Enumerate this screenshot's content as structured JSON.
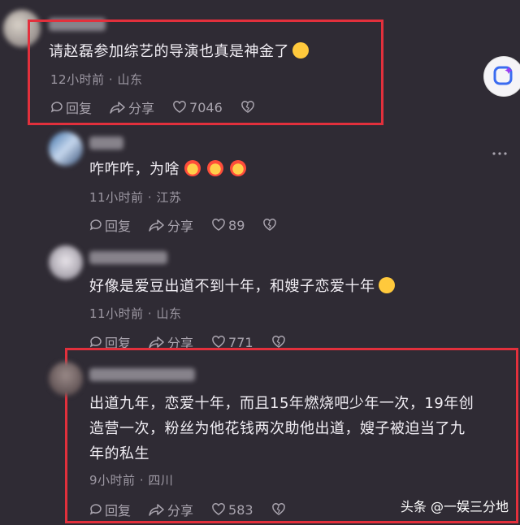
{
  "comments": [
    {
      "text": "请赵磊参加综艺的导演也真是神金了",
      "emoji": "smile",
      "time": "12小时前",
      "location": "山东",
      "reply": "回复",
      "share": "分享",
      "likes": "7046"
    },
    {
      "text": "咋咋咋，为啥",
      "emoji": "devil-x3",
      "time": "11小时前",
      "location": "江苏",
      "reply": "回复",
      "share": "分享",
      "likes": "89"
    },
    {
      "text": "好像是爱豆出道不到十年，和嫂子恋爱十年",
      "emoji": "dizzy",
      "time": "11小时前",
      "location": "山东",
      "reply": "回复",
      "share": "分享",
      "likes": "771"
    },
    {
      "text_lines": [
        "出道九年，恋爱十年，而且15年燃烧吧少年一次，19年创",
        "造营一次，粉丝为他花钱两次助他出道，嫂子被迫当了九",
        "年的私生"
      ],
      "time": "9小时前",
      "location": "四川",
      "reply": "回复",
      "share": "分享",
      "likes": "583"
    }
  ],
  "separator": "·",
  "watermark": "头条 @一娱三分地",
  "colors": {
    "background": "#2f2b34",
    "highlight_box": "#e2303c",
    "meta_text": "#9d98a3"
  }
}
